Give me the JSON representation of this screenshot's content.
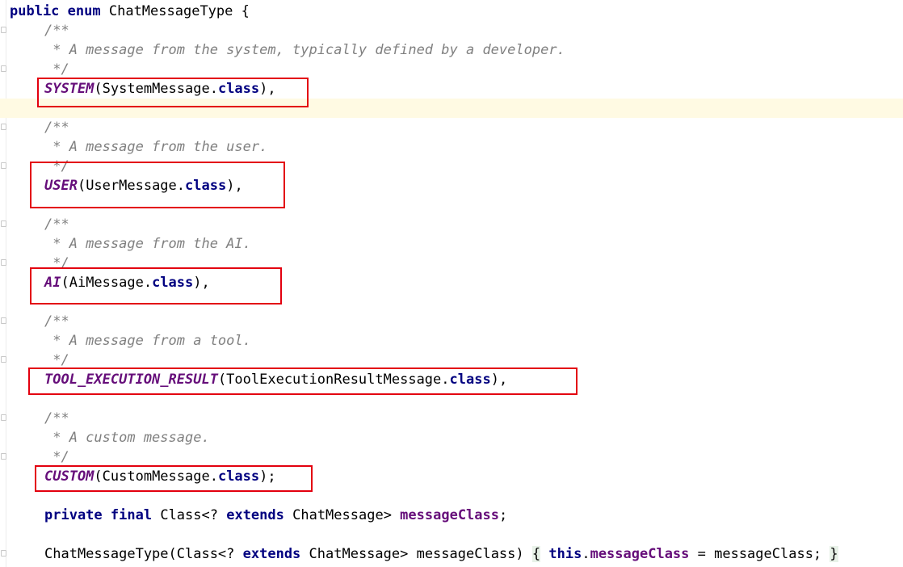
{
  "editor": {
    "header": {
      "kw1": "public",
      "kw2": "enum",
      "name": " ChatMessageType {"
    },
    "entries": [
      {
        "doc_open": "/**",
        "doc_text": " * A message from the system, typically defined by a developer.",
        "doc_close": " */",
        "const": "SYSTEM",
        "arg": "(SystemMessage.",
        "kw": "class",
        "tail": "),"
      },
      {
        "doc_open": "/**",
        "doc_text": " * A message from the user.",
        "doc_close": " */",
        "const": "USER",
        "arg": "(UserMessage.",
        "kw": "class",
        "tail": "),"
      },
      {
        "doc_open": "/**",
        "doc_text": " * A message from the AI.",
        "doc_close": " */",
        "const": "AI",
        "arg": "(AiMessage.",
        "kw": "class",
        "tail": "),"
      },
      {
        "doc_open": "/**",
        "doc_text": " * A message from a tool.",
        "doc_close": " */",
        "const": "TOOL_EXECUTION_RESULT",
        "arg": "(ToolExecutionResultMessage.",
        "kw": "class",
        "tail": "),"
      },
      {
        "doc_open": "/**",
        "doc_text": " * A custom message.",
        "doc_close": " */",
        "const": "CUSTOM",
        "arg": "(CustomMessage.",
        "kw": "class",
        "tail": ");"
      }
    ],
    "field_line": {
      "kw1": "private",
      "kw2": "final",
      "type1": " Class<? ",
      "kw3": "extends",
      "type2": " ChatMessage> ",
      "name": "messageClass",
      "end": ";"
    },
    "ctor_line": {
      "sig1": "ChatMessageType(Class<? ",
      "kw1": "extends",
      "sig2": " ChatMessage> messageClass) ",
      "open": "{",
      "kw2": "this",
      "dot": ".",
      "field": "messageClass",
      "assign": " = messageClass; ",
      "close": "}"
    }
  },
  "colors": {
    "keyword": "#000080",
    "comment": "#808080",
    "constant": "#660e7a",
    "highlight_box": "#e3000f",
    "caret_line": "#fffae3"
  }
}
